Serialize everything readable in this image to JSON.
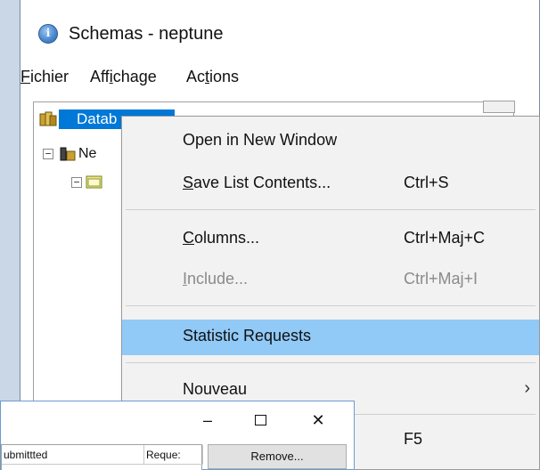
{
  "window": {
    "title": "Schemas - neptune",
    "icon": "app-info-icon",
    "menu": [
      {
        "pre": "",
        "u": "F",
        "post": "ichier"
      },
      {
        "pre": "Aff",
        "u": "i",
        "post": "chage"
      },
      {
        "pre": "Ac",
        "u": "t",
        "post": "ions"
      }
    ]
  },
  "tree": {
    "selected_label": "Datab",
    "child_label": "Ne"
  },
  "context_menu": {
    "items": [
      {
        "label": "Open in New Window",
        "shortcut": "",
        "disabled": false
      },
      {
        "label_u": "S",
        "label_rest": "ave List Contents...",
        "shortcut": "Ctrl+S",
        "disabled": false
      },
      {
        "label_u": "C",
        "label_rest": "olumns...",
        "shortcut": "Ctrl+Maj+C",
        "disabled": false
      },
      {
        "label_u": "I",
        "label_rest": "nclude...",
        "shortcut": "Ctrl+Maj+I",
        "disabled": true
      },
      {
        "label": "Statistic Requests",
        "shortcut": "",
        "highlighted": true
      },
      {
        "label": "Nouveau",
        "shortcut": "",
        "submenu": true
      },
      {
        "label": "",
        "shortcut": "F5"
      }
    ],
    "highlight_color": "#91c9f7"
  },
  "dialog": {
    "minimize": "–",
    "close": "✕",
    "col_submitted": "ubmittted",
    "col_request": "Reque:",
    "remove_label": "Remove..."
  },
  "colors": {
    "selection": "#0078d7",
    "menu_bg": "#f2f2f2"
  }
}
